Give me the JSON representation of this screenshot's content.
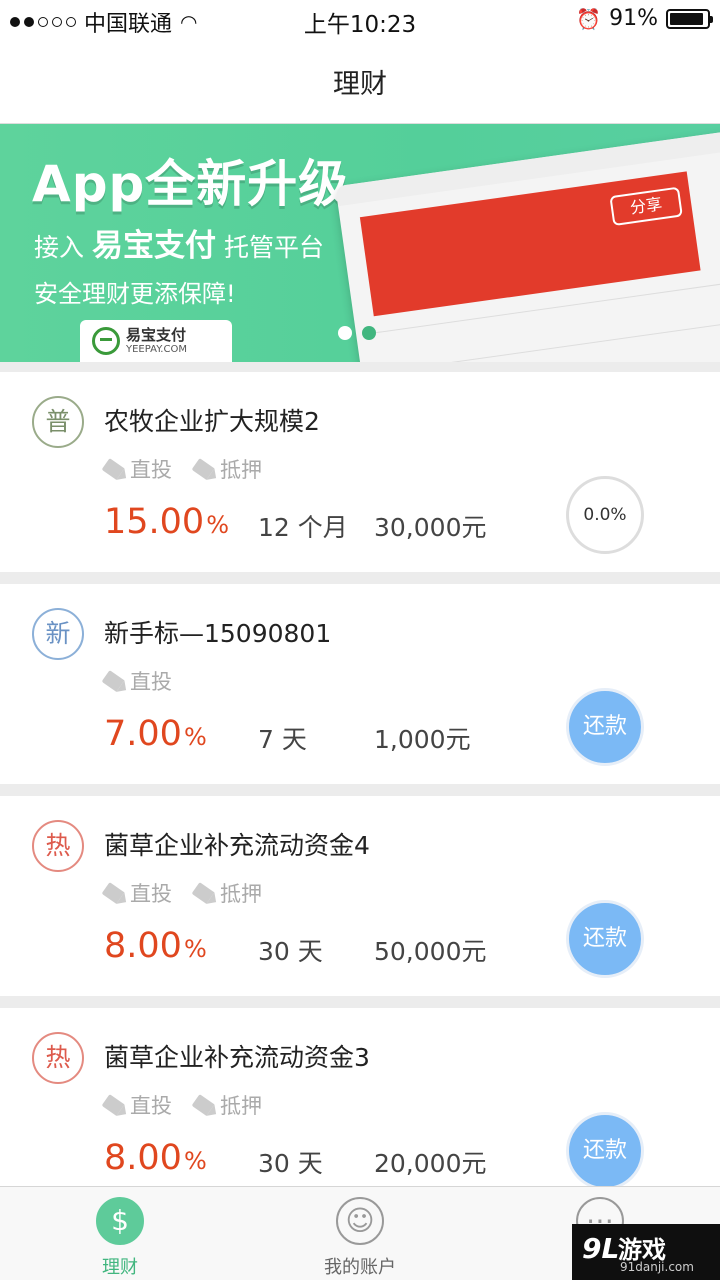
{
  "status_bar": {
    "carrier": "中国联通",
    "time": "上午10:23",
    "battery": "91%"
  },
  "nav": {
    "title": "理财"
  },
  "banner": {
    "headline": "App全新升级",
    "line2_prefix": "接入",
    "line2_brand": "易宝支付",
    "line2_suffix": "托管平台",
    "line3": "安全理财更添保障!",
    "logo_cn": "易宝支付",
    "logo_en": "YEEPAY.COM",
    "mock_button": "分享",
    "active_page": 2,
    "page_count": 2
  },
  "products": [
    {
      "badge": "普",
      "badge_type": "normal",
      "title": "农牧企业扩大规模2",
      "tags": [
        "直投",
        "抵押"
      ],
      "rate": "15.00",
      "rate_unit": "%",
      "term": "12 个月",
      "amount": "30,000元",
      "status": "0.0%"
    },
    {
      "badge": "新",
      "badge_type": "new",
      "title": "新手标—15090801",
      "tags": [
        "直投"
      ],
      "rate": "7.00",
      "rate_unit": "%",
      "term": "7 天",
      "amount": "1,000元",
      "status": "还款"
    },
    {
      "badge": "热",
      "badge_type": "hot",
      "title": "菌草企业补充流动资金4",
      "tags": [
        "直投",
        "抵押"
      ],
      "rate": "8.00",
      "rate_unit": "%",
      "term": "30 天",
      "amount": "50,000元",
      "status": "还款"
    },
    {
      "badge": "热",
      "badge_type": "hot",
      "title": "菌草企业补充流动资金3",
      "tags": [
        "直投",
        "抵押"
      ],
      "rate": "8.00",
      "rate_unit": "%",
      "term": "30 天",
      "amount": "20,000元",
      "status": "还款"
    }
  ],
  "tab_bar": {
    "tabs": [
      {
        "label": "理财",
        "icon": "dollar-icon",
        "glyph": "$",
        "active": true
      },
      {
        "label": "我的账户",
        "icon": "user-icon",
        "glyph": "☺",
        "active": false
      },
      {
        "label": "",
        "icon": "more-icon",
        "glyph": "⋯",
        "active": false
      }
    ]
  },
  "watermark": {
    "mark": "9L",
    "main": "游戏",
    "sub": "91danji.com"
  }
}
